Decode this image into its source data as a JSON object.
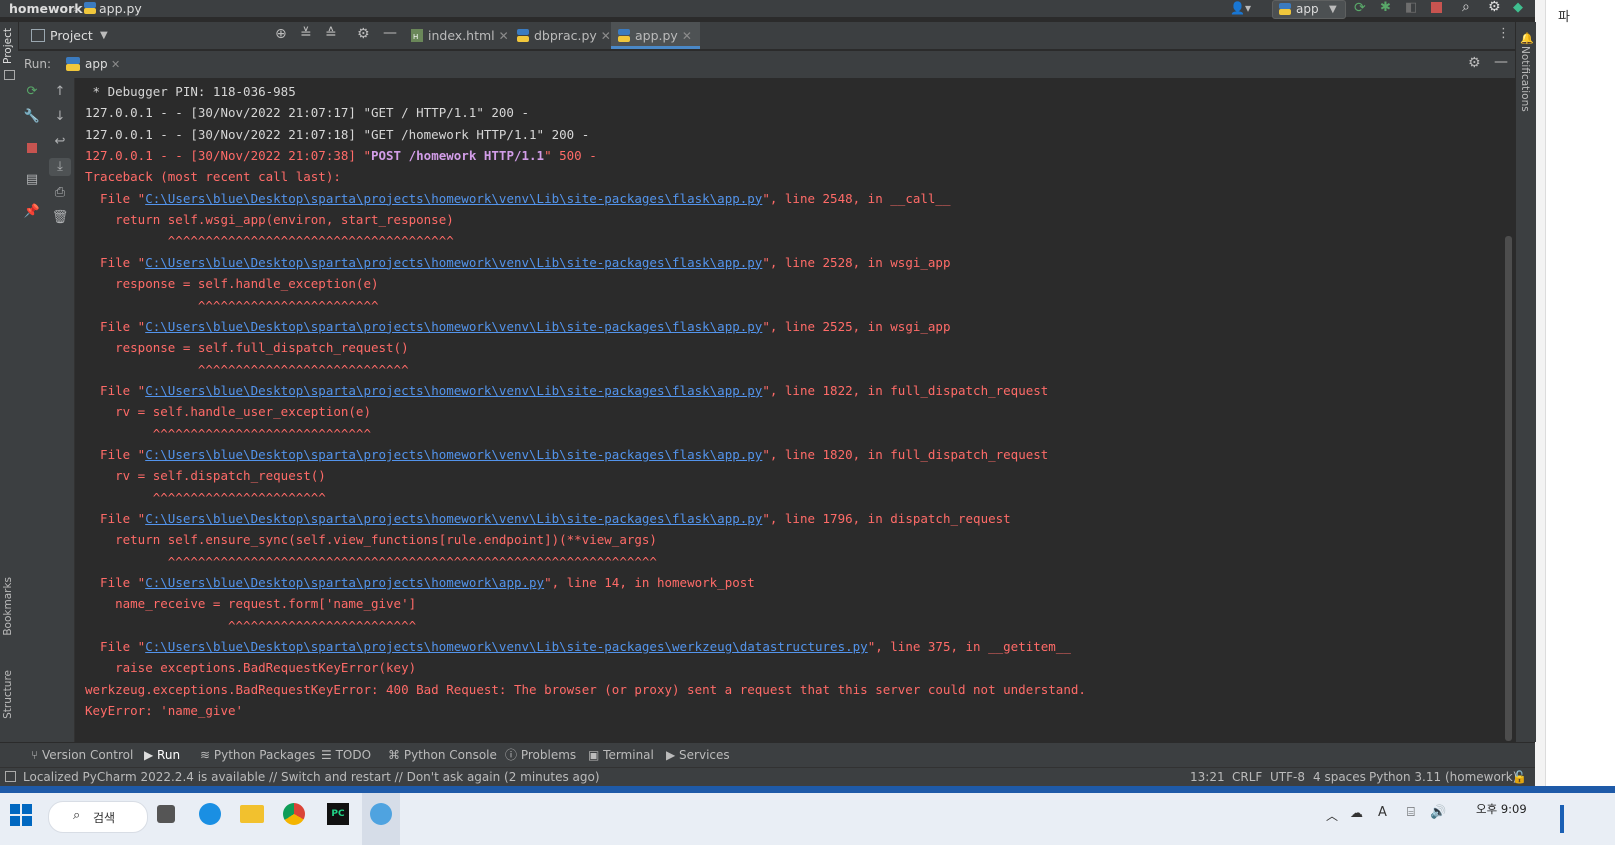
{
  "titlebar": {
    "project": "homework",
    "file": "app.py",
    "run_config": "app"
  },
  "toolbar": {
    "project_label": "Project",
    "tabs": [
      {
        "label": "index.html",
        "icon": "html-file-icon"
      },
      {
        "label": "dbprac.py",
        "icon": "python-file-icon"
      },
      {
        "label": "app.py",
        "icon": "python-file-icon",
        "active": true
      }
    ]
  },
  "run": {
    "label": "Run:",
    "tab": "app"
  },
  "stripes": {
    "left_top": "Project",
    "bookmarks": "Bookmarks",
    "structure": "Structure",
    "notifications": "Notifications"
  },
  "console": {
    "lines": [
      {
        "text": " * Debugger PIN: 118-036-985",
        "style": "white"
      },
      {
        "text": "127.0.0.1 - - [30/Nov/2022 21:07:17] \"GET / HTTP/1.1\" 200 -",
        "style": "white"
      },
      {
        "text": "127.0.0.1 - - [30/Nov/2022 21:07:18] \"GET /homework HTTP/1.1\" 200 -",
        "style": "white"
      },
      {
        "pre": "127.0.0.1 - - [30/Nov/2022 21:07:38] \"",
        "bold": "POST /homework HTTP/1.1",
        "post": "\" 500 -",
        "style": "red"
      },
      {
        "text": "Traceback (most recent call last):",
        "style": "red"
      },
      {
        "pre": "  File \"",
        "link": "C:\\Users\\blue\\Desktop\\sparta\\projects\\homework\\venv\\Lib\\site-packages\\flask\\app.py",
        "post": "\", line 2548, in __call__",
        "style": "red"
      },
      {
        "text": "    return self.wsgi_app(environ, start_response)",
        "style": "red"
      },
      {
        "text": "           ^^^^^^^^^^^^^^^^^^^^^^^^^^^^^^^^^^^^^^",
        "style": "red"
      },
      {
        "pre": "  File \"",
        "link": "C:\\Users\\blue\\Desktop\\sparta\\projects\\homework\\venv\\Lib\\site-packages\\flask\\app.py",
        "post": "\", line 2528, in wsgi_app",
        "style": "red"
      },
      {
        "text": "    response = self.handle_exception(e)",
        "style": "red"
      },
      {
        "text": "               ^^^^^^^^^^^^^^^^^^^^^^^^",
        "style": "red"
      },
      {
        "pre": "  File \"",
        "link": "C:\\Users\\blue\\Desktop\\sparta\\projects\\homework\\venv\\Lib\\site-packages\\flask\\app.py",
        "post": "\", line 2525, in wsgi_app",
        "style": "red"
      },
      {
        "text": "    response = self.full_dispatch_request()",
        "style": "red"
      },
      {
        "text": "               ^^^^^^^^^^^^^^^^^^^^^^^^^^^^",
        "style": "red"
      },
      {
        "pre": "  File \"",
        "link": "C:\\Users\\blue\\Desktop\\sparta\\projects\\homework\\venv\\Lib\\site-packages\\flask\\app.py",
        "post": "\", line 1822, in full_dispatch_request",
        "style": "red"
      },
      {
        "text": "    rv = self.handle_user_exception(e)",
        "style": "red"
      },
      {
        "text": "         ^^^^^^^^^^^^^^^^^^^^^^^^^^^^^",
        "style": "red"
      },
      {
        "pre": "  File \"",
        "link": "C:\\Users\\blue\\Desktop\\sparta\\projects\\homework\\venv\\Lib\\site-packages\\flask\\app.py",
        "post": "\", line 1820, in full_dispatch_request",
        "style": "red"
      },
      {
        "text": "    rv = self.dispatch_request()",
        "style": "red"
      },
      {
        "text": "         ^^^^^^^^^^^^^^^^^^^^^^^",
        "style": "red"
      },
      {
        "pre": "  File \"",
        "link": "C:\\Users\\blue\\Desktop\\sparta\\projects\\homework\\venv\\Lib\\site-packages\\flask\\app.py",
        "post": "\", line 1796, in dispatch_request",
        "style": "red"
      },
      {
        "text": "    return self.ensure_sync(self.view_functions[rule.endpoint])(**view_args)",
        "style": "red"
      },
      {
        "text": "           ^^^^^^^^^^^^^^^^^^^^^^^^^^^^^^^^^^^^^^^^^^^^^^^^^^^^^^^^^^^^^^^^^",
        "style": "red"
      },
      {
        "pre": "  File \"",
        "link": "C:\\Users\\blue\\Desktop\\sparta\\projects\\homework\\app.py",
        "post": "\", line 14, in homework_post",
        "style": "red"
      },
      {
        "text": "    name_receive = request.form['name_give']",
        "style": "red"
      },
      {
        "text": "                   ^^^^^^^^^^^^^^^^^^^^^^^^^",
        "style": "red"
      },
      {
        "pre": "  File \"",
        "link": "C:\\Users\\blue\\Desktop\\sparta\\projects\\homework\\venv\\Lib\\site-packages\\werkzeug\\datastructures.py",
        "post": "\", line 375, in __getitem__",
        "style": "red"
      },
      {
        "text": "    raise exceptions.BadRequestKeyError(key)",
        "style": "red"
      },
      {
        "text": "werkzeug.exceptions.BadRequestKeyError: 400 Bad Request: The browser (or proxy) sent a request that this server could not understand.",
        "style": "red"
      },
      {
        "text": "KeyError: 'name_give'",
        "style": "red"
      }
    ]
  },
  "bottom_tabs": [
    {
      "label": "Version Control",
      "icon": "branch-icon"
    },
    {
      "label": "Run",
      "icon": "run-icon",
      "active": true
    },
    {
      "label": "Python Packages",
      "icon": "layers-icon"
    },
    {
      "label": "TODO",
      "icon": "list-icon"
    },
    {
      "label": "Python Console",
      "icon": "python-icon"
    },
    {
      "label": "Problems",
      "icon": "info-icon"
    },
    {
      "label": "Terminal",
      "icon": "terminal-icon"
    },
    {
      "label": "Services",
      "icon": "services-icon"
    }
  ],
  "status": {
    "message": "Localized PyCharm 2022.2.4 is available // Switch and restart // Don't ask again (2 minutes ago)",
    "position": "13:21",
    "line_sep": "CRLF",
    "encoding": "UTF-8",
    "indent": "4 spaces",
    "interpreter": "Python 3.11 (homework)"
  },
  "taskbar": {
    "search": "검색",
    "time": "오후 9:09"
  },
  "colors": {
    "console_bg": "#2b2b2b",
    "panel_bg": "#3c3f41",
    "error_red": "#ff6b68",
    "link_blue": "#5394ec",
    "accent": "#4a88c7"
  }
}
